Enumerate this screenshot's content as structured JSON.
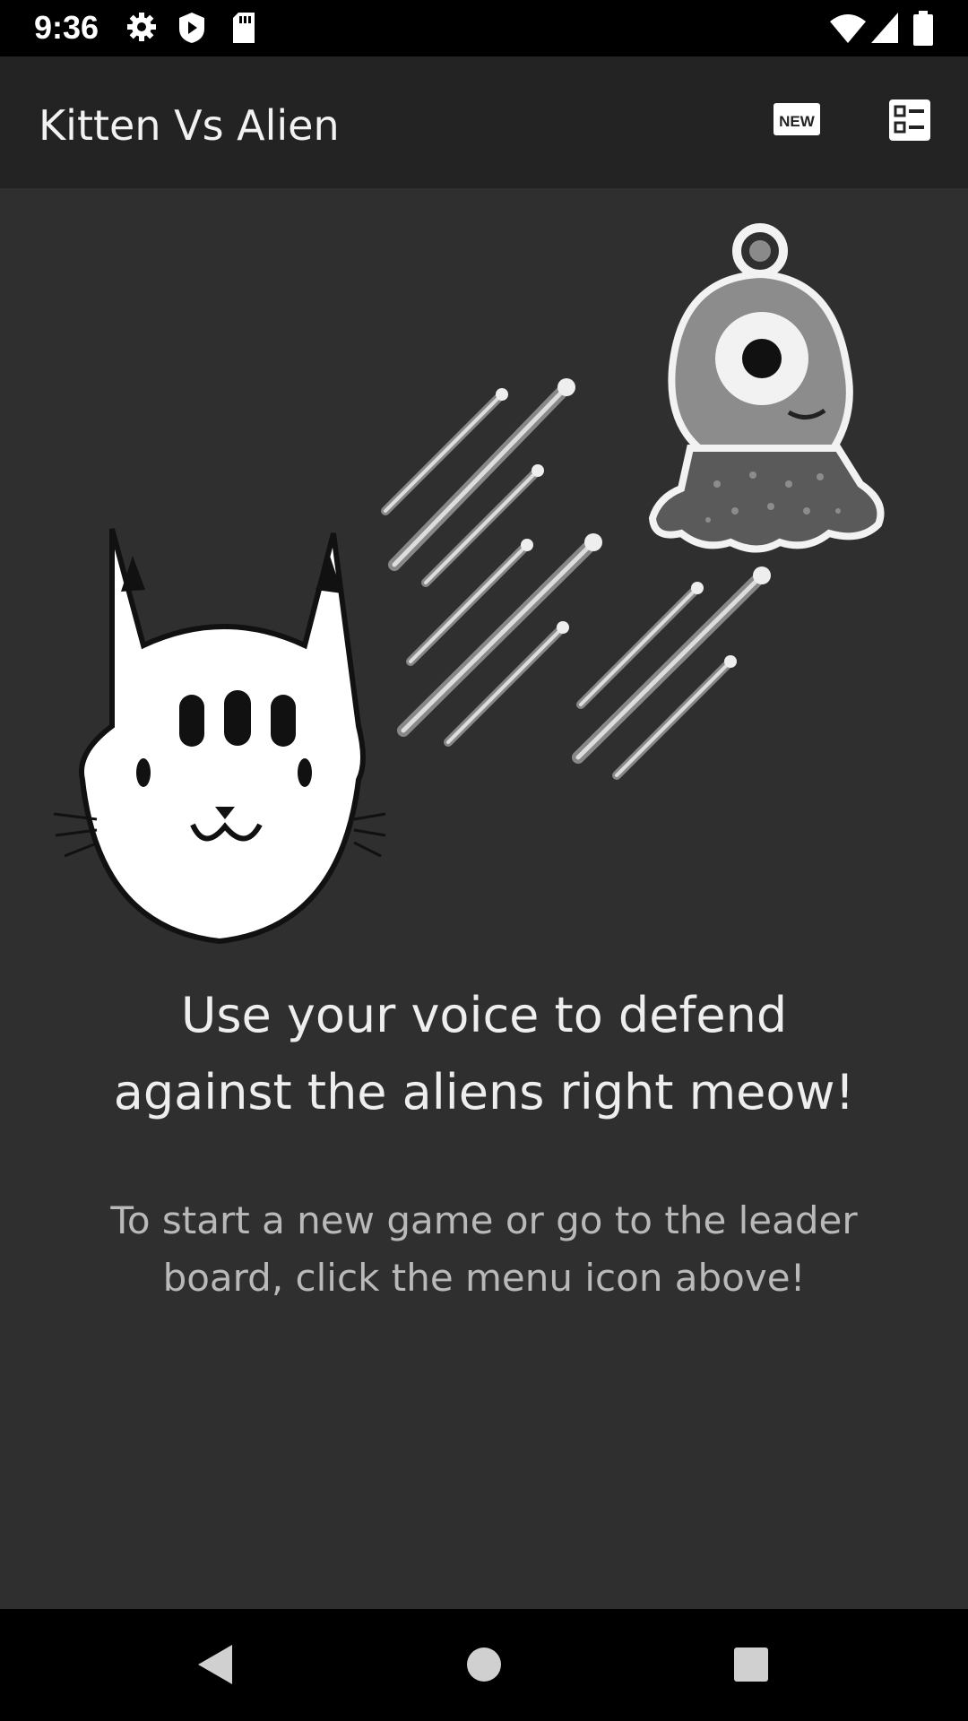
{
  "status_bar": {
    "time": "9:36",
    "left_icons": [
      "gear-icon",
      "shield-play-icon",
      "sd-card-icon"
    ],
    "right_icons": [
      "wifi-icon",
      "signal-icon",
      "battery-icon"
    ]
  },
  "app_bar": {
    "title": "Kitten Vs Alien",
    "new_game_icon": "NEW",
    "menu_icon": "leaderboard-list-icon"
  },
  "content": {
    "tagline": "Use your voice to defend\nagainst the aliens right meow!",
    "hint": "To start a new game or go to the leader\nboard, click the menu icon above!"
  },
  "nav_bar": {
    "buttons": [
      "back-icon",
      "home-icon",
      "recents-icon"
    ]
  },
  "colors": {
    "background": "#2f2f2f",
    "app_bar": "#232323",
    "system_bars": "#000000",
    "text_primary": "#eeeeee",
    "text_secondary": "#b9b9b9"
  }
}
